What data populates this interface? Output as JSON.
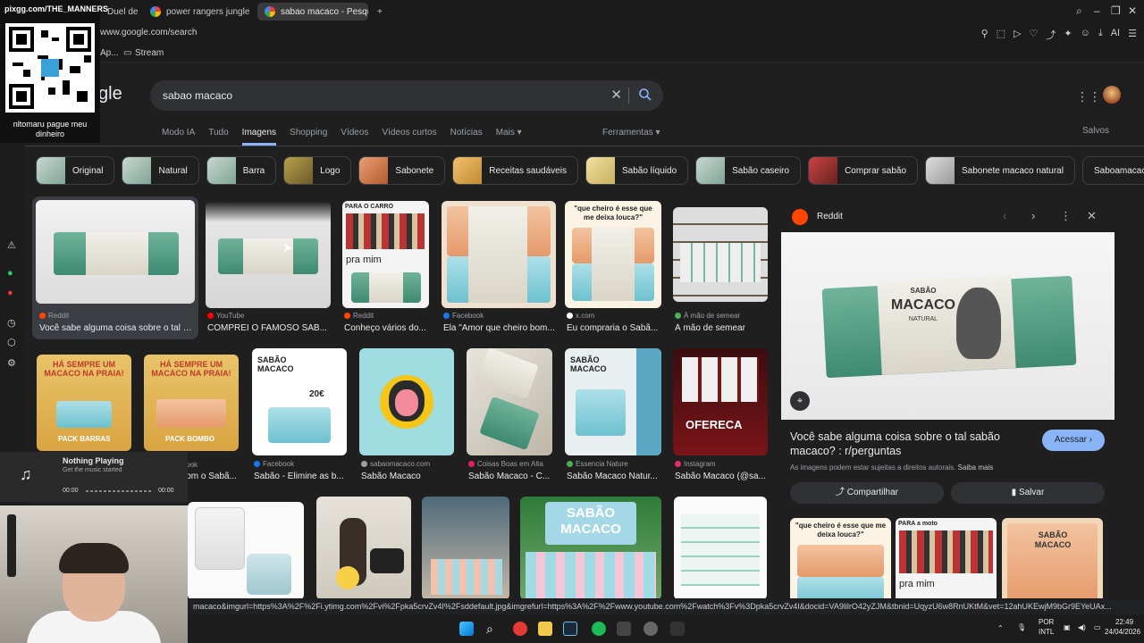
{
  "browser": {
    "tabs": [
      {
        "label": "Duel de Rosto - ( parte"
      },
      {
        "label": "power rangers jungle fury"
      },
      {
        "label": "sabao macaco - Pesquisa"
      }
    ],
    "new_tab": "+",
    "url": "www.google.com/search",
    "bookmarks": {
      "app": "Ap...",
      "stream": "Stream"
    }
  },
  "overlay": {
    "handle": "pixgg.com/THE_MANNERS",
    "caption": "nltomaru pague meu dinheiro"
  },
  "search": {
    "logo": "gle",
    "query": "sabao macaco",
    "nav": [
      "Modo IA",
      "Tudo",
      "Imagens",
      "Shopping",
      "Vídeos",
      "Vídeos curtos",
      "Notícias",
      "Mais ▾"
    ],
    "selected_nav": "Imagens",
    "tools": "Ferramentas ▾",
    "saved": "Salvos",
    "chips": [
      "Original",
      "Natural",
      "Barra",
      "Logo",
      "Sabonete",
      "Receitas saudáveis",
      "Sabão líquido",
      "Sabão caseiro",
      "Comprar sabão",
      "Sabonete macaco natural",
      "Saboamacaconatural's p"
    ]
  },
  "results": [
    {
      "source": "Reddit",
      "title": "Você sabe alguma coisa sobre o tal s...",
      "fav": "#ff4500"
    },
    {
      "source": "YouTube",
      "title": "COMPREI O FAMOSO SAB...",
      "fav": "#ff0000"
    },
    {
      "source": "Reddit",
      "title": "Conheço vários do...",
      "fav": "#ff4500",
      "overlay_top": "PARA O CARRO",
      "overlay_bottom": "pra mim"
    },
    {
      "source": "Facebook",
      "title": "Ela \"Amor que cheiro bom...",
      "fav": "#1877f2"
    },
    {
      "source": "x.com",
      "title": "Eu compraria o Sabã...",
      "fav": "#ffffff",
      "quote": "\"que cheiro é esse que me deixa louca?\""
    },
    {
      "source": "À mão de semear",
      "title": "À mão de semear",
      "fav": "#4caf50"
    },
    {
      "source": "",
      "title": "",
      "fav": "#888",
      "overlay_top": "HÁ SEMPRE UM MACACO NA PRAIA!",
      "overlay_bottom": "PACK BARRAS"
    },
    {
      "source": "...book",
      "title": "Com o Sabã...",
      "fav": "#1877f2",
      "overlay_top": "HÁ SEMPRE UM MACACO NA PRAIA!",
      "overlay_bottom": "PACK BOMBO"
    },
    {
      "source": "Facebook",
      "title": "Sabão - Elimine as b...",
      "fav": "#1877f2",
      "brand": "SABÃO MACACO",
      "price": "20€"
    },
    {
      "source": "sabaomacaco.com",
      "title": "Sabão Macaco",
      "fav": "#9aa0a6"
    },
    {
      "source": "Coisas Boas em Alta",
      "title": "Sabão Macaco - C...",
      "fav": "#e91e63"
    },
    {
      "source": "Essencia Nature",
      "title": "Sabão Macaco Natur...",
      "fav": "#4caf50",
      "brand": "SABÃO MACACO"
    },
    {
      "source": "Instagram",
      "title": "Sabão Macaco (@sa...",
      "fav": "#e1306c",
      "overlay_bottom": "OFERECA"
    },
    {
      "source": "",
      "title": "",
      "fav": "#888",
      "overlay_top": "SABÃO MACACO"
    }
  ],
  "panel": {
    "source": "Reddit",
    "title": "Você sabe alguma coisa sobre o tal sabão macaco? : r/perguntas",
    "access": "Acessar ›",
    "note": "As imagens podem estar sujeitas a direitos autorais.",
    "learn_more": "Saiba mais",
    "share": "Compartilhar",
    "save": "Salvar",
    "soap_brand": "SABÃO",
    "soap_name": "MACACO",
    "soap_sub": "NATURAL",
    "related": [
      {
        "caption": "\"que cheiro é esse que me deixa louca?\""
      },
      {
        "caption": "pra mim",
        "top": "PARA a moto"
      },
      {
        "caption": "SABÃO MACACO"
      }
    ]
  },
  "status_url": "macaco&imgurl=https%3A%2F%2Fi.ytimg.com%2Fvi%2Fpka5crvZv4I%2Fsddefault.jpg&imgrefurl=https%3A%2F%2Fwww.youtube.com%2Fwatch%3Fv%3Dpka5crvZv4I&docid=VA9lilrO42yZJM&tbnid=UqyzU6w8RnUKtM&vet=12ahUKEwjM9bGr9EYeUAx...",
  "music": {
    "title": "Nothing Playing",
    "subtitle": "Get the music started",
    "time_start": "00:00",
    "time_end": "00:00"
  },
  "system": {
    "lang1": "POR",
    "lang2": "INTL",
    "time": "22:49",
    "date": "24/04/2026"
  }
}
